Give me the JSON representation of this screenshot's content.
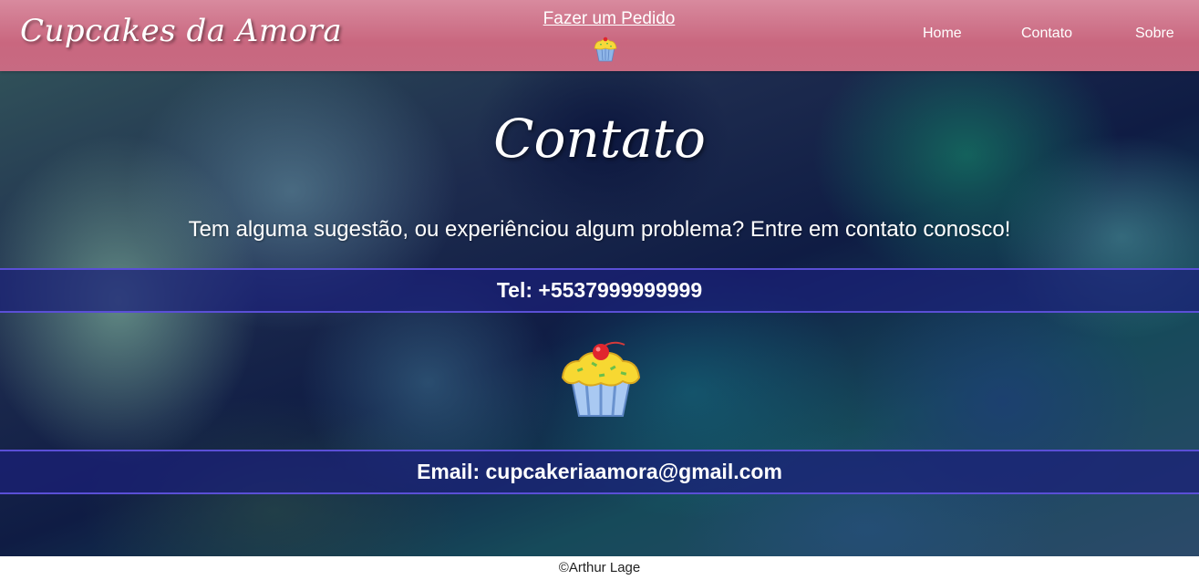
{
  "header": {
    "logo_text": "Cupcakes da Amora",
    "order_link": "Fazer um Pedido",
    "order_icon": "cupcake-icon",
    "nav": {
      "home": "Home",
      "contato": "Contato",
      "sobre": "Sobre"
    }
  },
  "main": {
    "title": "Contato",
    "subtitle": "Tem alguma sugestão, ou experiênciou algum problema? Entre em contato conosco!",
    "phone": "Tel: +5537999999999",
    "center_icon": "cupcake-icon",
    "email": "Email: cupcakeriaamora@gmail.com"
  },
  "footer": {
    "credit": "©Arthur Lage"
  },
  "colors": {
    "header_pink": "#c9677f",
    "band_blue": "#1a2078",
    "band_border": "#5a4fd6",
    "footer_bg": "#ffffff"
  }
}
